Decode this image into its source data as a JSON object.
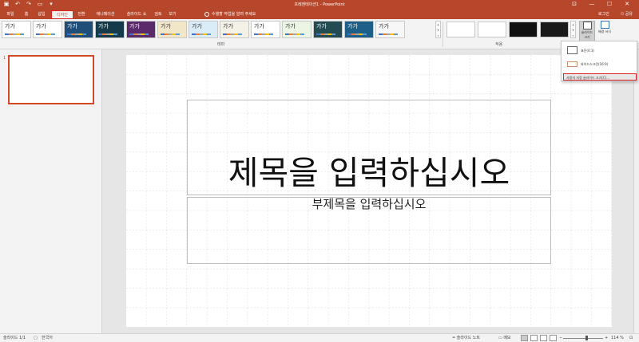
{
  "app": {
    "window_title": "프레젠테이션1 - PowerPoint",
    "win_controls": [
      "—",
      "☐",
      "✕"
    ],
    "qat_icons": [
      "save-icon",
      "undo-icon",
      "redo-icon",
      "slideshow-icon",
      "customize-qat-icon"
    ]
  },
  "tabs": [
    {
      "label": "파일"
    },
    {
      "label": "홈"
    },
    {
      "label": "삽입"
    },
    {
      "label": "디자인",
      "active": true
    },
    {
      "label": "전환"
    },
    {
      "label": "애니메이션"
    },
    {
      "label": "슬라이드 쇼"
    },
    {
      "label": "검토"
    },
    {
      "label": "보기"
    }
  ],
  "tell_me": "수행할 작업을 알려 주세요",
  "account": {
    "signin": "로그인",
    "share": "공유"
  },
  "ribbon": {
    "theme_sample_text": "가가",
    "group_theme_label": "테마",
    "group_variant_label": "적용",
    "slide_size_label": "슬라이드 크기",
    "format_bg_label": "배경 서식",
    "theme_colors": [
      "#ffffff",
      "#ffffff",
      "#1f4e79",
      "#153a4a",
      "#5a2a6a",
      "#f2e6c9",
      "#d9ecf7",
      "#f4f1e6",
      "#ffffff",
      "#eaf5e4",
      "#234b52",
      "#1d5f86",
      "#f7f7f7",
      "#2b2b2b"
    ],
    "variant_colors": [
      "#ffffff",
      "#ffffff",
      "#111111",
      "#1a1a1a"
    ]
  },
  "slide_size_menu": {
    "standard": "표준(4:3)",
    "widescreen": "와이드스크린(16:9)",
    "custom": "사용자 지정 슬라이드 크기(C)..."
  },
  "thumbnails": {
    "slide_number": "1"
  },
  "slide": {
    "title_placeholder": "제목을 입력하십시오",
    "subtitle_placeholder": "부제목을 입력하십시오"
  },
  "status": {
    "slide_counter": "슬라이드 1/1",
    "language": "한국어",
    "notes": "슬라이드 노트",
    "comments": "메모",
    "zoom": "114 %",
    "zoom_level_percent": 114
  }
}
